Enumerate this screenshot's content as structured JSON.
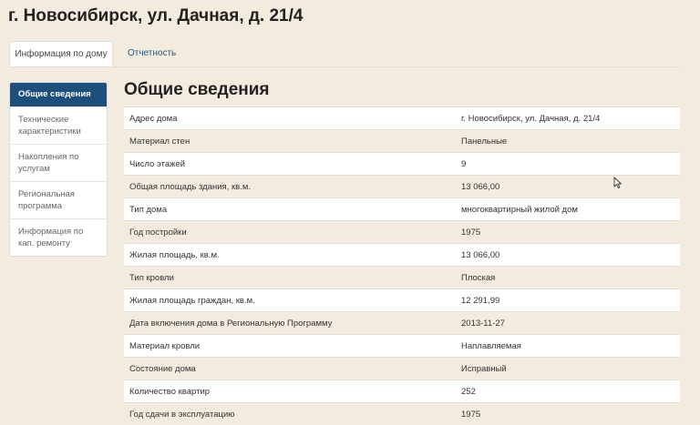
{
  "page": {
    "title": "г. Новосибирск, ул. Дачная, д. 21/4"
  },
  "tabs": [
    {
      "label": "Информация по дому",
      "active": true
    },
    {
      "label": "Отчетность",
      "active": false
    }
  ],
  "sidebar": {
    "items": [
      {
        "label": "Общие сведения",
        "active": true
      },
      {
        "label": "Технические характеристики"
      },
      {
        "label": "Накопления по услугам"
      },
      {
        "label": "Региональная программа"
      },
      {
        "label": "Информация по кап. ремонту"
      }
    ]
  },
  "main": {
    "section_title": "Общие сведения",
    "rows": [
      {
        "label": "Адрес дома",
        "value": "г. Новосибирск, ул. Дачная, д. 21/4"
      },
      {
        "label": "Материал стен",
        "value": "Панельные"
      },
      {
        "label": "Число этажей",
        "value": "9"
      },
      {
        "label": "Общая площадь здания, кв.м.",
        "value": "13 066,00"
      },
      {
        "label": "Тип дома",
        "value": "многоквартирный жилой дом"
      },
      {
        "label": "Год постройки",
        "value": "1975"
      },
      {
        "label": "Жилая площадь, кв.м.",
        "value": "13 066,00"
      },
      {
        "label": "Тип кровли",
        "value": "Плоская"
      },
      {
        "label": "Жилая площадь граждан, кв.м.",
        "value": "12 291,99"
      },
      {
        "label": "Дата включения дома в Региональную Программу",
        "value": "2013-11-27"
      },
      {
        "label": "Материал кровли",
        "value": "Наплавляемая"
      },
      {
        "label": "Состояние дома",
        "value": "Исправный"
      },
      {
        "label": "Количество квартир",
        "value": "252"
      },
      {
        "label": "Год сдачи в эксплуатацию",
        "value": "1975"
      }
    ]
  },
  "colors": {
    "background": "#f3ebde",
    "accent": "#1d4f7c",
    "link": "#1f5a8a"
  }
}
